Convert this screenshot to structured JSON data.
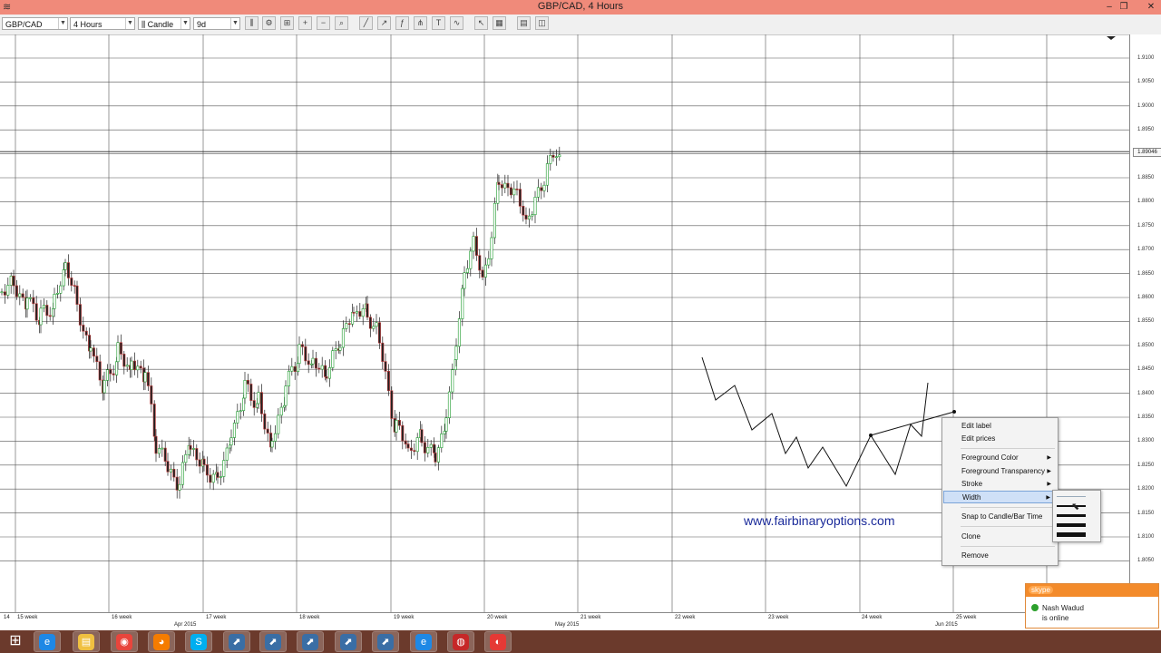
{
  "window": {
    "title": "GBP/CAD, 4 Hours",
    "minimize": "–",
    "restore": "❐",
    "close": "✕"
  },
  "toolbar": {
    "symbol": "GBP/CAD",
    "timeframe": "4 Hours",
    "chart_type": "Candle",
    "period": "9d",
    "buttons": [
      "bar-style",
      "properties",
      "zoom-fit",
      "zoom-in",
      "zoom-out",
      "zoom-area",
      "draw-line",
      "trend-line",
      "fibonacci",
      "pitchfork",
      "text-tool",
      "indicators",
      "cursor",
      "grid",
      "templates",
      "layout"
    ]
  },
  "price_axis": {
    "labels": [
      "1.9100",
      "1.9050",
      "1.9000",
      "1.8950",
      "1.8900",
      "1.8850",
      "1.8800",
      "1.8750",
      "1.8700",
      "1.8650",
      "1.8600",
      "1.8550",
      "1.8500",
      "1.8450",
      "1.8400",
      "1.8350",
      "1.8300",
      "1.8250",
      "1.8200",
      "1.8150",
      "1.8100",
      "1.8050"
    ],
    "current": "1.89046"
  },
  "time_axis": {
    "weeks": [
      "14",
      "15 week",
      "16 week",
      "17 week",
      "18 week",
      "19 week",
      "20 week",
      "21 week",
      "22 week",
      "23 week",
      "24 week",
      "25 week"
    ],
    "months": [
      "Apr 2015",
      "May 2015",
      "Jun 2015"
    ]
  },
  "watermark": "www.fairbinaryoptions.com",
  "context_menu": {
    "items": [
      "Edit label",
      "Edit prices",
      "Foreground Color",
      "Foreground Transparency",
      "Stroke",
      "Width",
      "Snap to Candle/Bar Time",
      "Clone",
      "Remove"
    ],
    "highlighted": "Width",
    "width_options": [
      "1",
      "2",
      "3",
      "4",
      "5"
    ]
  },
  "notification": {
    "app": "skype",
    "name": "Nash Wadud",
    "status": "is online"
  },
  "taskbar": {
    "icons": [
      "windows-start-icon",
      "internet-explorer-icon",
      "file-explorer-icon",
      "chrome-icon",
      "firefox-icon",
      "skype-icon",
      "trading-app-icon",
      "trading-app-icon",
      "trading-app-icon",
      "trading-app-icon",
      "trading-app-icon",
      "internet-explorer-icon",
      "media-player-icon",
      "paint-icon"
    ]
  },
  "colors": {
    "titlebar": "#f08a7a",
    "taskbar": "#6b3a2c",
    "candle_up": "#1a9a2a",
    "candle_down": "#c23b3b",
    "watermark": "#1a2a9a"
  }
}
